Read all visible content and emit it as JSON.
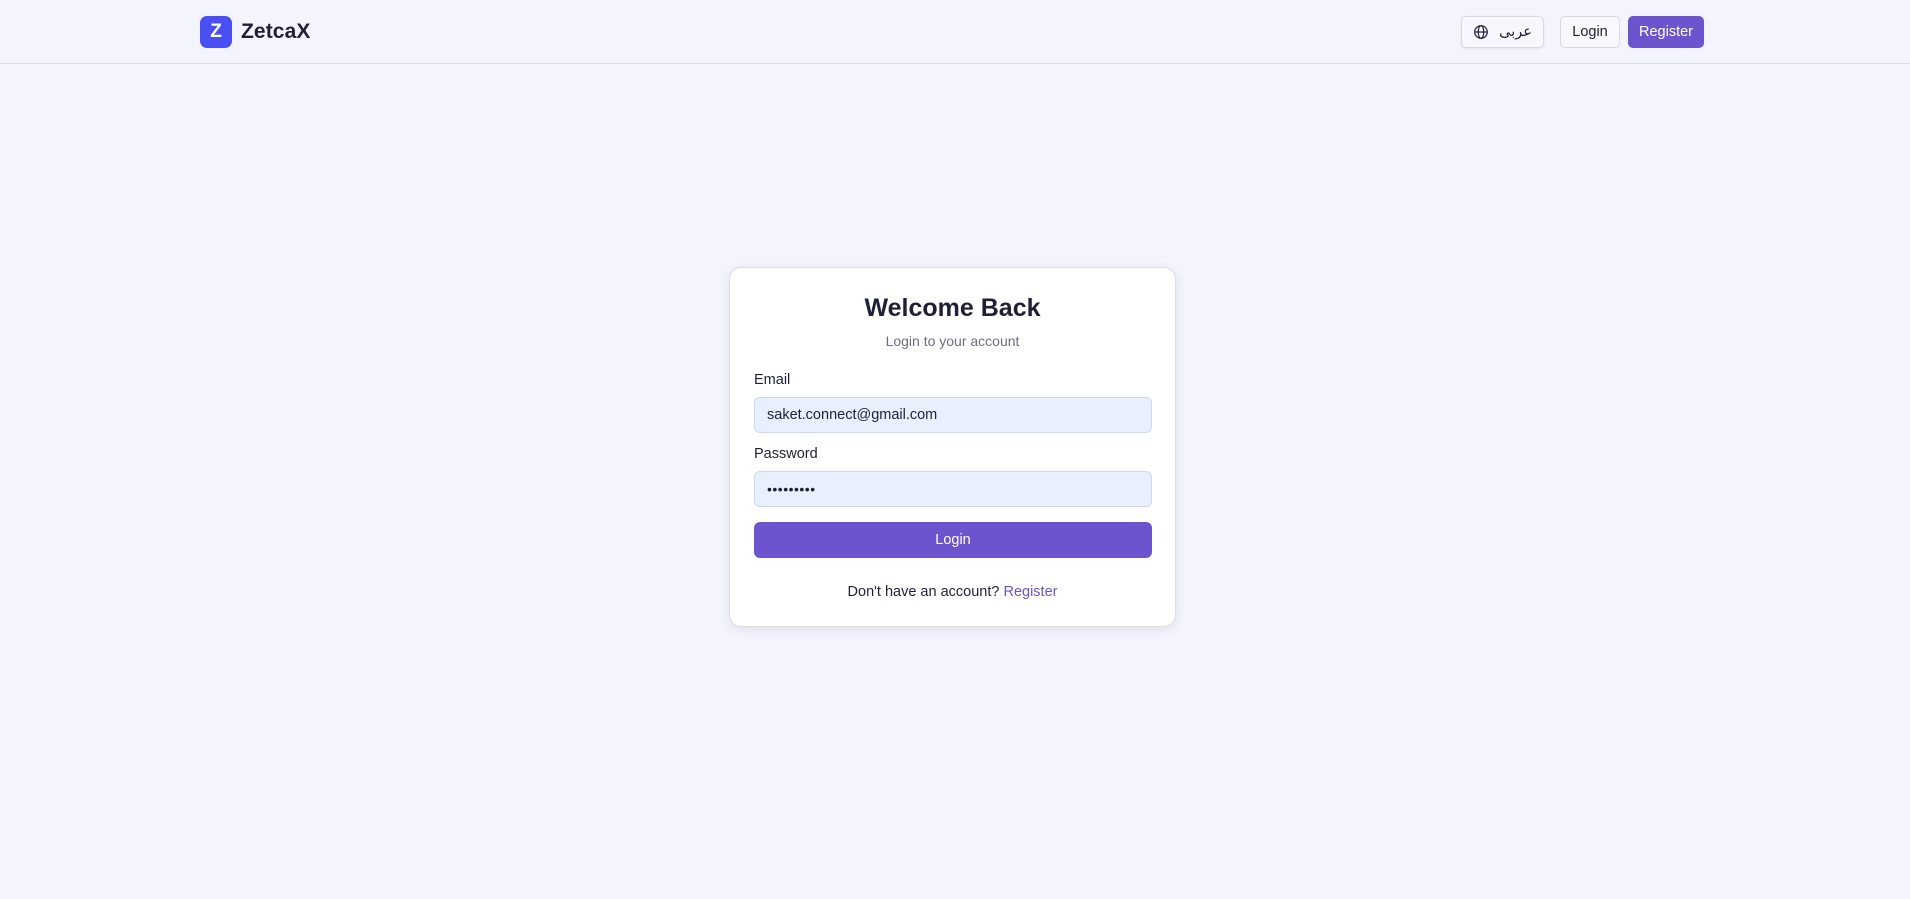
{
  "header": {
    "brand": {
      "mark": "Z",
      "name": "ZetcaX",
      "mark_color": "#4a4ff3"
    },
    "language_button": {
      "icon": "globe-icon",
      "label": "عربى"
    },
    "login_label": "Login",
    "register_label": "Register"
  },
  "login_card": {
    "title": "Welcome Back",
    "subtitle": "Login to your account",
    "email": {
      "label": "Email",
      "value": "saket.connect@gmail.com"
    },
    "password": {
      "label": "Password",
      "value": "•••••••••"
    },
    "submit_label": "Login",
    "footer": {
      "prompt": "Don't have an account?",
      "link_label": "Register"
    }
  },
  "colors": {
    "accent": "#6d54cf",
    "brand": "#4a4ff3",
    "page_background": "#f3f4fd",
    "input_background": "#e8effd"
  }
}
